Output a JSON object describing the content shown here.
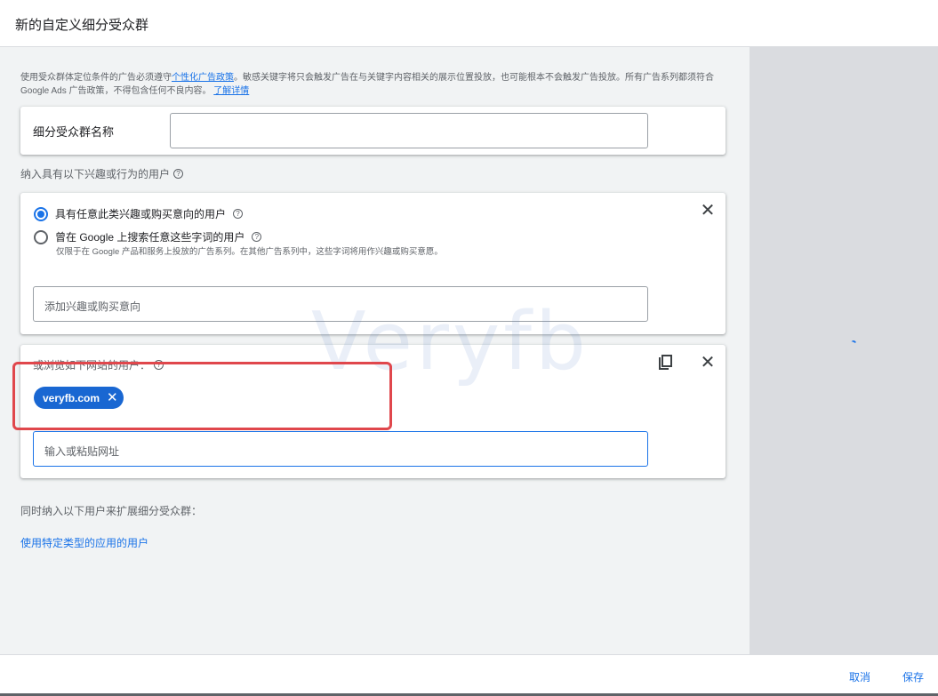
{
  "header": {
    "title": "新的自定义细分受众群"
  },
  "policy": {
    "text_before": "使用受众群体定位条件的广告必须遵守",
    "link1": "个性化广告政策",
    "text_after": "。敏感关键字将只会触发广告在与关键字内容相关的展示位置投放，也可能根本不会触发广告投放。所有广告系列都须符合 Google Ads 广告政策，不得包含任何不良内容。",
    "link2": "了解详情"
  },
  "name_card": {
    "label": "细分受众群名称",
    "value": ""
  },
  "interests_section": {
    "label": "纳入具有以下兴趣或行为的用户"
  },
  "interest_card": {
    "option1": "具有任意此类兴趣或购买意向的用户",
    "option2": "曾在 Google 上搜索任意这些字词的用户",
    "option2_note": "仅限于在 Google 产品和服务上投放的广告系列。在其他广告系列中，这些字词将用作兴趣或购买意愿。",
    "input_placeholder": "添加兴趣或购买意向"
  },
  "url_card": {
    "label": "或浏览如下网站的用户：",
    "chip": "veryfb.com",
    "input_placeholder": "输入或粘贴网址"
  },
  "watermark": "Veryfb",
  "also_section": {
    "label": "同时纳入以下用户来扩展细分受众群：",
    "app_link": "使用特定类型的应用的用户"
  },
  "footer": {
    "cancel": "取消",
    "save": "保存"
  },
  "colors": {
    "accent": "#1a73e8",
    "chip": "#1967d2",
    "highlight": "#e0474c"
  },
  "icons": {
    "close": "close-icon",
    "help": "help-icon",
    "copy": "copy-icon"
  }
}
